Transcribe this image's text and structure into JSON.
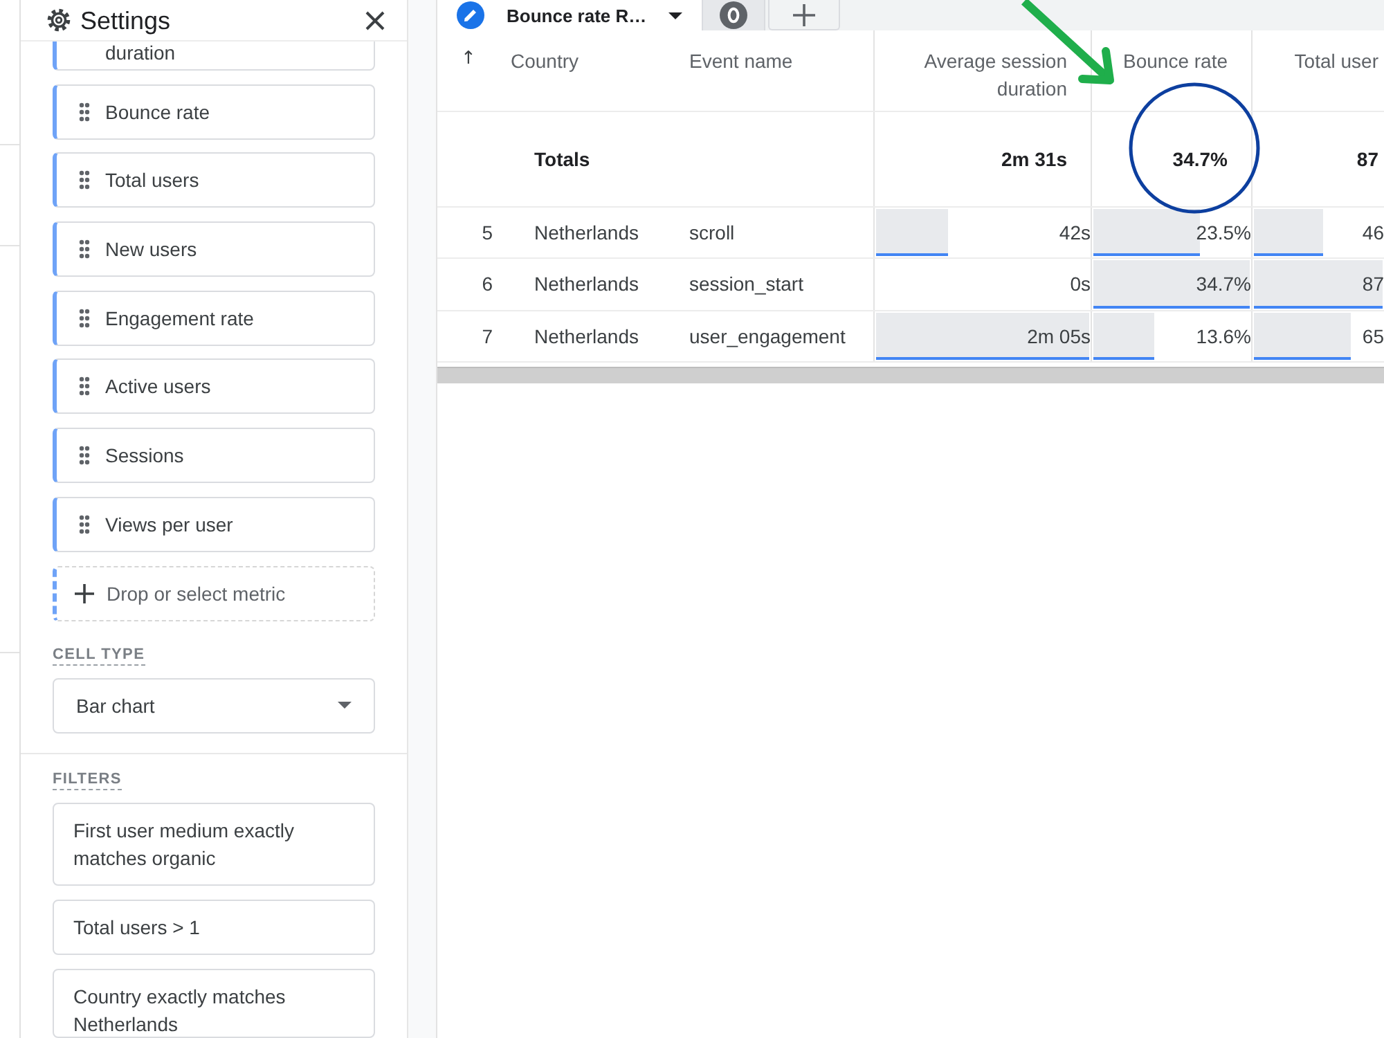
{
  "settings": {
    "title": "Settings",
    "metrics": [
      {
        "label": "duration"
      },
      {
        "label": "Bounce rate"
      },
      {
        "label": "Total users"
      },
      {
        "label": "New users"
      },
      {
        "label": "Engagement rate"
      },
      {
        "label": "Active users"
      },
      {
        "label": "Sessions"
      },
      {
        "label": "Views per user"
      }
    ],
    "drop_zone": {
      "label": "Drop or select metric"
    },
    "cell_type": {
      "heading": "CELL TYPE",
      "value": "Bar chart"
    },
    "filters": {
      "heading": "FILTERS",
      "items": [
        {
          "label": "First user medium exactly matches organic"
        },
        {
          "label": "Total users > 1"
        },
        {
          "label": "Country exactly matches Netherlands"
        }
      ]
    }
  },
  "tabs": [
    {
      "kind": "edit",
      "label": "Bounce rate R…",
      "selected": true
    },
    {
      "kind": "icon",
      "selected": false
    }
  ],
  "table": {
    "columns": [
      {
        "kind": "index",
        "label": "↑"
      },
      {
        "kind": "text",
        "label": "Country"
      },
      {
        "kind": "text",
        "label": "Event name"
      },
      {
        "kind": "bar",
        "label": "Average session duration"
      },
      {
        "kind": "bar",
        "label": "Bounce rate"
      },
      {
        "kind": "bar",
        "label": "Total user"
      }
    ],
    "totals": {
      "label": "Totals",
      "values": [
        "2m 31s",
        "34.7%",
        "87"
      ]
    },
    "rows": [
      {
        "cells": [
          {
            "text": "5"
          },
          {
            "text": "Netherlands"
          },
          {
            "text": "scroll"
          },
          {
            "text": "42s",
            "level": 0.34
          },
          {
            "text": "23.5%",
            "level": 0.68
          },
          {
            "text": "46",
            "level": 0.54
          }
        ]
      },
      {
        "cells": [
          {
            "text": "6"
          },
          {
            "text": "Netherlands"
          },
          {
            "text": "session_start"
          },
          {
            "text": "0s"
          },
          {
            "text": "34.7%",
            "level": 1
          },
          {
            "text": "87",
            "level": 1
          }
        ]
      },
      {
        "cells": [
          {
            "text": "7"
          },
          {
            "text": "Netherlands"
          },
          {
            "text": "user_engagement"
          },
          {
            "text": "2m 05s",
            "level": 1
          },
          {
            "text": "13.6%",
            "level": 0.39
          },
          {
            "text": "65",
            "level": 0.75
          }
        ]
      }
    ]
  },
  "annotations": [
    {
      "kind": "arrow"
    },
    {
      "kind": "circle"
    }
  ]
}
